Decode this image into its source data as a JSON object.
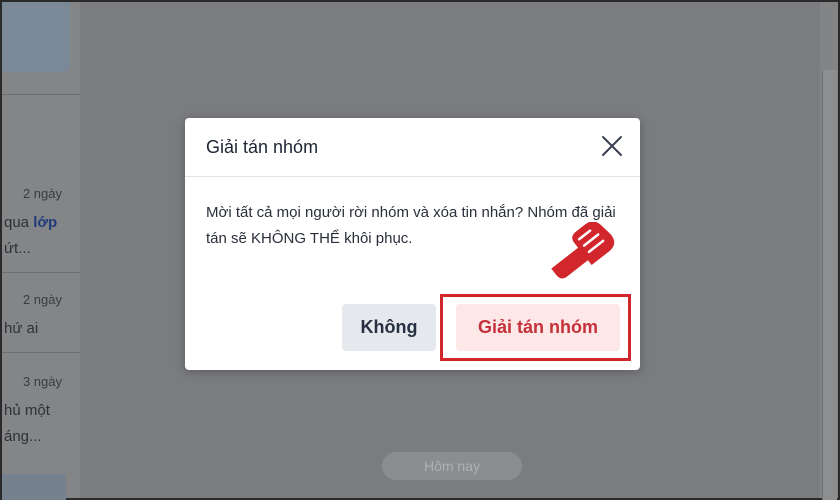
{
  "sidebar": {
    "items": [
      {
        "time": "2 ngày",
        "line1_prefix": "qua ",
        "line1_link": "lớp",
        "line2": "ứt..."
      },
      {
        "time": "2 ngày",
        "line1": "hứ ai"
      },
      {
        "time": "3 ngày",
        "line1": "hủ một",
        "line2": "áng..."
      }
    ]
  },
  "chat": {
    "date_pill": "Hôm nay"
  },
  "dialog": {
    "title": "Giải tán nhóm",
    "message": "Mời tất cả mọi người rời nhóm và xóa tin nhắn? Nhóm đã giải tán sẽ KHÔNG THỂ khôi phục.",
    "cancel_label": "Không",
    "confirm_label": "Giải tán nhóm"
  },
  "colors": {
    "confirm_bg": "#fde7e7",
    "confirm_text": "#c4313a",
    "highlight": "#d0262c",
    "overlay": "#7a7c7f"
  }
}
